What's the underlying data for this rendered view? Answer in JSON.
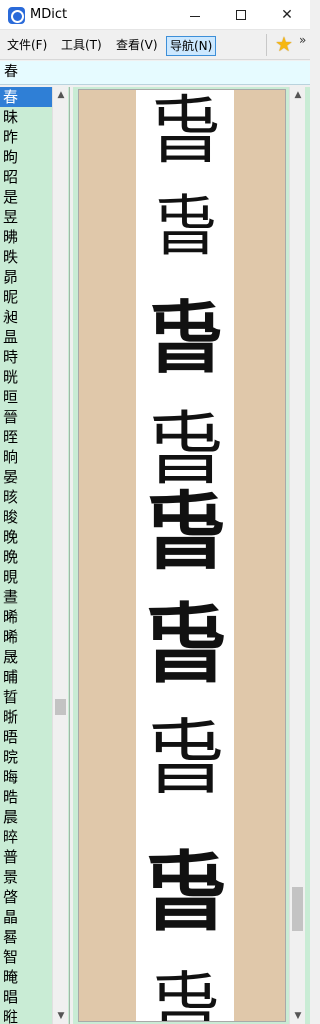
{
  "window": {
    "title": "MDict",
    "minimize": "─",
    "maximize": "□",
    "close": "✕"
  },
  "menu": {
    "file": "文件(F)",
    "tools": "工具(T)",
    "view": "查看(V)",
    "navigate": "导航(N)",
    "overflow": "»"
  },
  "search": {
    "value": "春"
  },
  "wordlist": {
    "selected_index": 0,
    "items": [
      "春",
      "昧",
      "昨",
      "昫",
      "昭",
      "是",
      "昱",
      "昲",
      "昳",
      "昴",
      "昵",
      "昶",
      "昷",
      "時",
      "晄",
      "晅",
      "晉",
      "晊",
      "晌",
      "晏",
      "晐",
      "晙",
      "晚",
      "晩",
      "晛",
      "晝",
      "晞",
      "晞",
      "晟",
      "晡",
      "晢",
      "晣",
      "晤",
      "晥",
      "晦",
      "晧",
      "晨",
      "晬",
      "普",
      "景",
      "晵",
      "晶",
      "晷",
      "智",
      "晻",
      "晿",
      "暀"
    ]
  },
  "content": {
    "glyphs": [
      "𣌮",
      "𣌮",
      "舂",
      "𣌮",
      "萅",
      "𣌮",
      "𣌮",
      "𣌮",
      "𣌮"
    ],
    "glyph_rendered": [
      "旾",
      "旾",
      "旾",
      "旾",
      "旾",
      "旾",
      "旾",
      "旾",
      "旾"
    ]
  },
  "colors": {
    "list_bg": "#c9ecd5",
    "selection": "#2f7fd6",
    "search_bg": "#e6fbff",
    "content_margin": "#e0c8aa",
    "menu_active": "#cce8ff"
  },
  "icons": [
    "app-icon",
    "star-icon",
    "chevron-up-icon",
    "chevron-down-icon"
  ]
}
